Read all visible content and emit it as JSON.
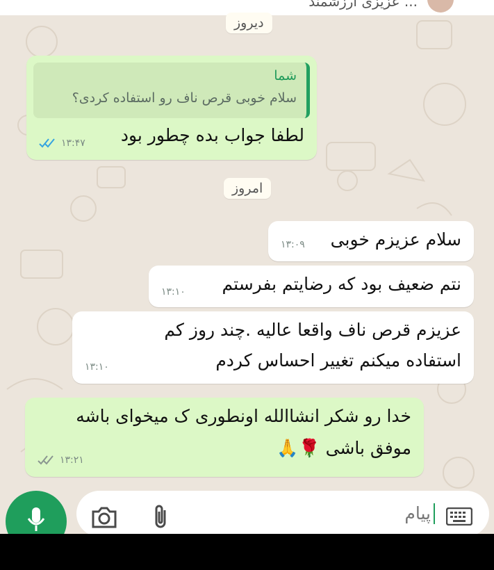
{
  "header": {
    "title": "... عزیزی ارزشمند"
  },
  "colors": {
    "outgoing_bubble": "#dcf8c6",
    "incoming_bubble": "#ffffff",
    "accent": "#1f9e5c",
    "read_ticks": "#34a3e0"
  },
  "dates": {
    "yesterday": "دیروز",
    "today": "امروز"
  },
  "messages": [
    {
      "direction": "out",
      "quote": {
        "author": "شما",
        "text": "سلام خوبی قرص ناف رو استفاده کردی؟"
      },
      "text": "لطفا جواب بده چطور بود",
      "time": "۱۳:۴۷",
      "status": "read"
    },
    {
      "direction": "in",
      "text": "سلام عزیزم خوبی",
      "time": "۱۳:۰۹"
    },
    {
      "direction": "in",
      "text": "نتم ضعیف بود که رضایتم بفرستم",
      "time": "۱۳:۱۰"
    },
    {
      "direction": "in",
      "lines": [
        "عزیزم قرص ناف واقعا عالیه .چند روز کم",
        "استفاده میکنم تغییر احساس کردم"
      ],
      "time": "۱۳:۱۰"
    },
    {
      "direction": "out",
      "lines": [
        "خدا رو شکر انشاالله اونطوری ک میخوای باشه",
        "موفق باشی 🌹🙏"
      ],
      "time": "۱۳:۲۱",
      "status": "delivered"
    }
  ],
  "composer": {
    "placeholder": "پیام",
    "icons": [
      "keyboard-icon",
      "attach-icon",
      "camera-icon",
      "mic-icon"
    ]
  }
}
